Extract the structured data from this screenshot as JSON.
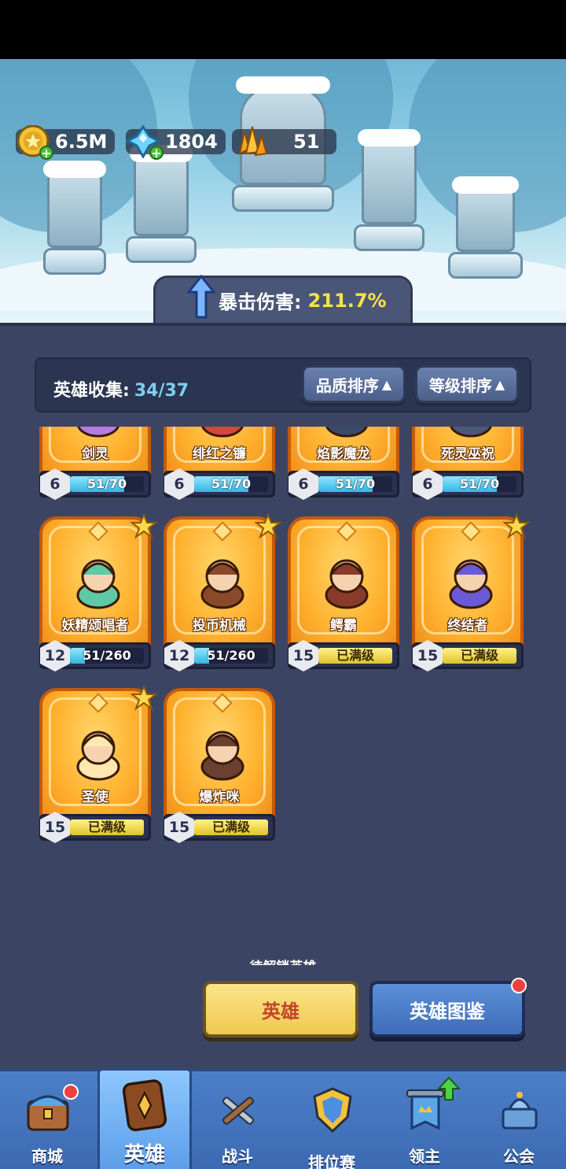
{
  "resources": {
    "gold": "6.5M",
    "gems": "1804",
    "crystals": "51"
  },
  "crit": {
    "label": "暴击伤害:",
    "value": "211.7%"
  },
  "collection": {
    "label": "英雄收集:",
    "count": "34/37",
    "sort_quality": "品质排序",
    "sort_level": "等级排序"
  },
  "heroes": [
    {
      "name": "剑灵",
      "level": "6",
      "progress": "51/70",
      "progress_fraction": 0.73,
      "maxed": false,
      "star": false
    },
    {
      "name": "绯红之镰",
      "level": "6",
      "progress": "51/70",
      "progress_fraction": 0.73,
      "maxed": false,
      "star": false
    },
    {
      "name": "焰影魔龙",
      "level": "6",
      "progress": "51/70",
      "progress_fraction": 0.73,
      "maxed": false,
      "star": false
    },
    {
      "name": "死灵巫祝",
      "level": "6",
      "progress": "51/70",
      "progress_fraction": 0.73,
      "maxed": false,
      "star": false
    },
    {
      "name": "妖精颂唱者",
      "level": "12",
      "progress": "51/260",
      "progress_fraction": 0.2,
      "maxed": false,
      "star": true
    },
    {
      "name": "投币机械",
      "level": "12",
      "progress": "51/260",
      "progress_fraction": 0.2,
      "maxed": false,
      "star": true
    },
    {
      "name": "鳄霸",
      "level": "15",
      "progress": "已满级",
      "progress_fraction": 1,
      "maxed": true,
      "star": false
    },
    {
      "name": "终结者",
      "level": "15",
      "progress": "已满级",
      "progress_fraction": 1,
      "maxed": true,
      "star": true
    },
    {
      "name": "圣使",
      "level": "15",
      "progress": "已满级",
      "progress_fraction": 1,
      "maxed": true,
      "star": true
    },
    {
      "name": "爆炸咪",
      "level": "15",
      "progress": "已满级",
      "progress_fraction": 1,
      "maxed": true,
      "star": false
    }
  ],
  "locked_section": {
    "title": "待解锁英雄"
  },
  "buttons": {
    "heroes": "英雄",
    "codex": "英雄图鉴"
  },
  "nav": {
    "shop": "商城",
    "heroes": "英雄",
    "battle": "战斗",
    "ranked": "排位赛",
    "lord": "领主",
    "guild": "公会"
  },
  "colors": {
    "panel": "#3b4563",
    "card_orange": "#ffb12e",
    "progress_blue": "#35b6e2",
    "maxed_gold": "#e0c22a",
    "crit_value": "#f7e34b",
    "nav_blue": "#4c7fc8"
  },
  "icons": {
    "gold": "gold-coin-icon",
    "gems": "blue-gem-icon",
    "crystals": "orange-crystal-icon",
    "crit": "up-arrow-icon",
    "star": "star-icon"
  }
}
